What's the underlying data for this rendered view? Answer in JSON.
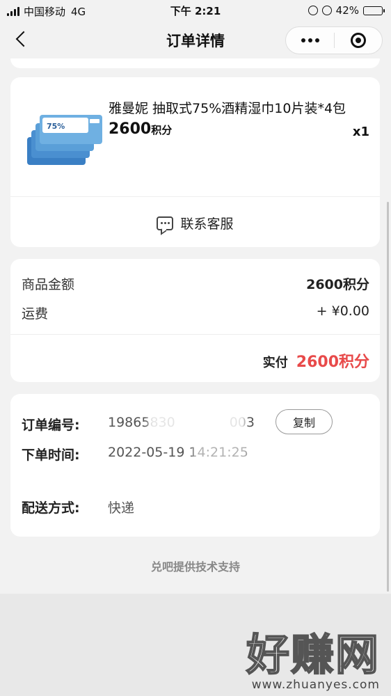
{
  "status_bar": {
    "carrier": "中国移动",
    "network": "4G",
    "time": "下午 2:21",
    "battery": "42%",
    "battery_level": 0.42
  },
  "nav": {
    "title": "订单详情",
    "back_icon": "chevron-left-icon",
    "more_icon": "more-dots-icon",
    "close_icon": "target-close-icon"
  },
  "product": {
    "name": "雅曼妮 抽取式75%酒精湿巾10片装*4包",
    "price": "2600",
    "price_unit": "积分",
    "quantity": "x1",
    "image_badge": "75%",
    "contact_service": "联系客服"
  },
  "amounts": {
    "goods_label": "商品金额",
    "goods_value": "2600积分",
    "shipping_label": "运费",
    "shipping_value": "+ ¥0.00",
    "paid_label": "实付",
    "paid_value": "2600积分"
  },
  "order_info": {
    "order_no_label": "订单编号:",
    "order_no_value": "19865830",
    "order_no_tail": "003",
    "copy_button": "复制",
    "order_time_label": "下单时间:",
    "order_time_value": "2022-05-19 14:21:25",
    "delivery_label": "配送方式:",
    "delivery_value": "快递"
  },
  "footer": {
    "support_text": "兑吧提供技术支持"
  },
  "watermark": {
    "brand": "好赚网",
    "url": "www.zhuanyes.com"
  },
  "colors": {
    "accent_red": "#e84a4a",
    "background": "#f2f2f2"
  }
}
